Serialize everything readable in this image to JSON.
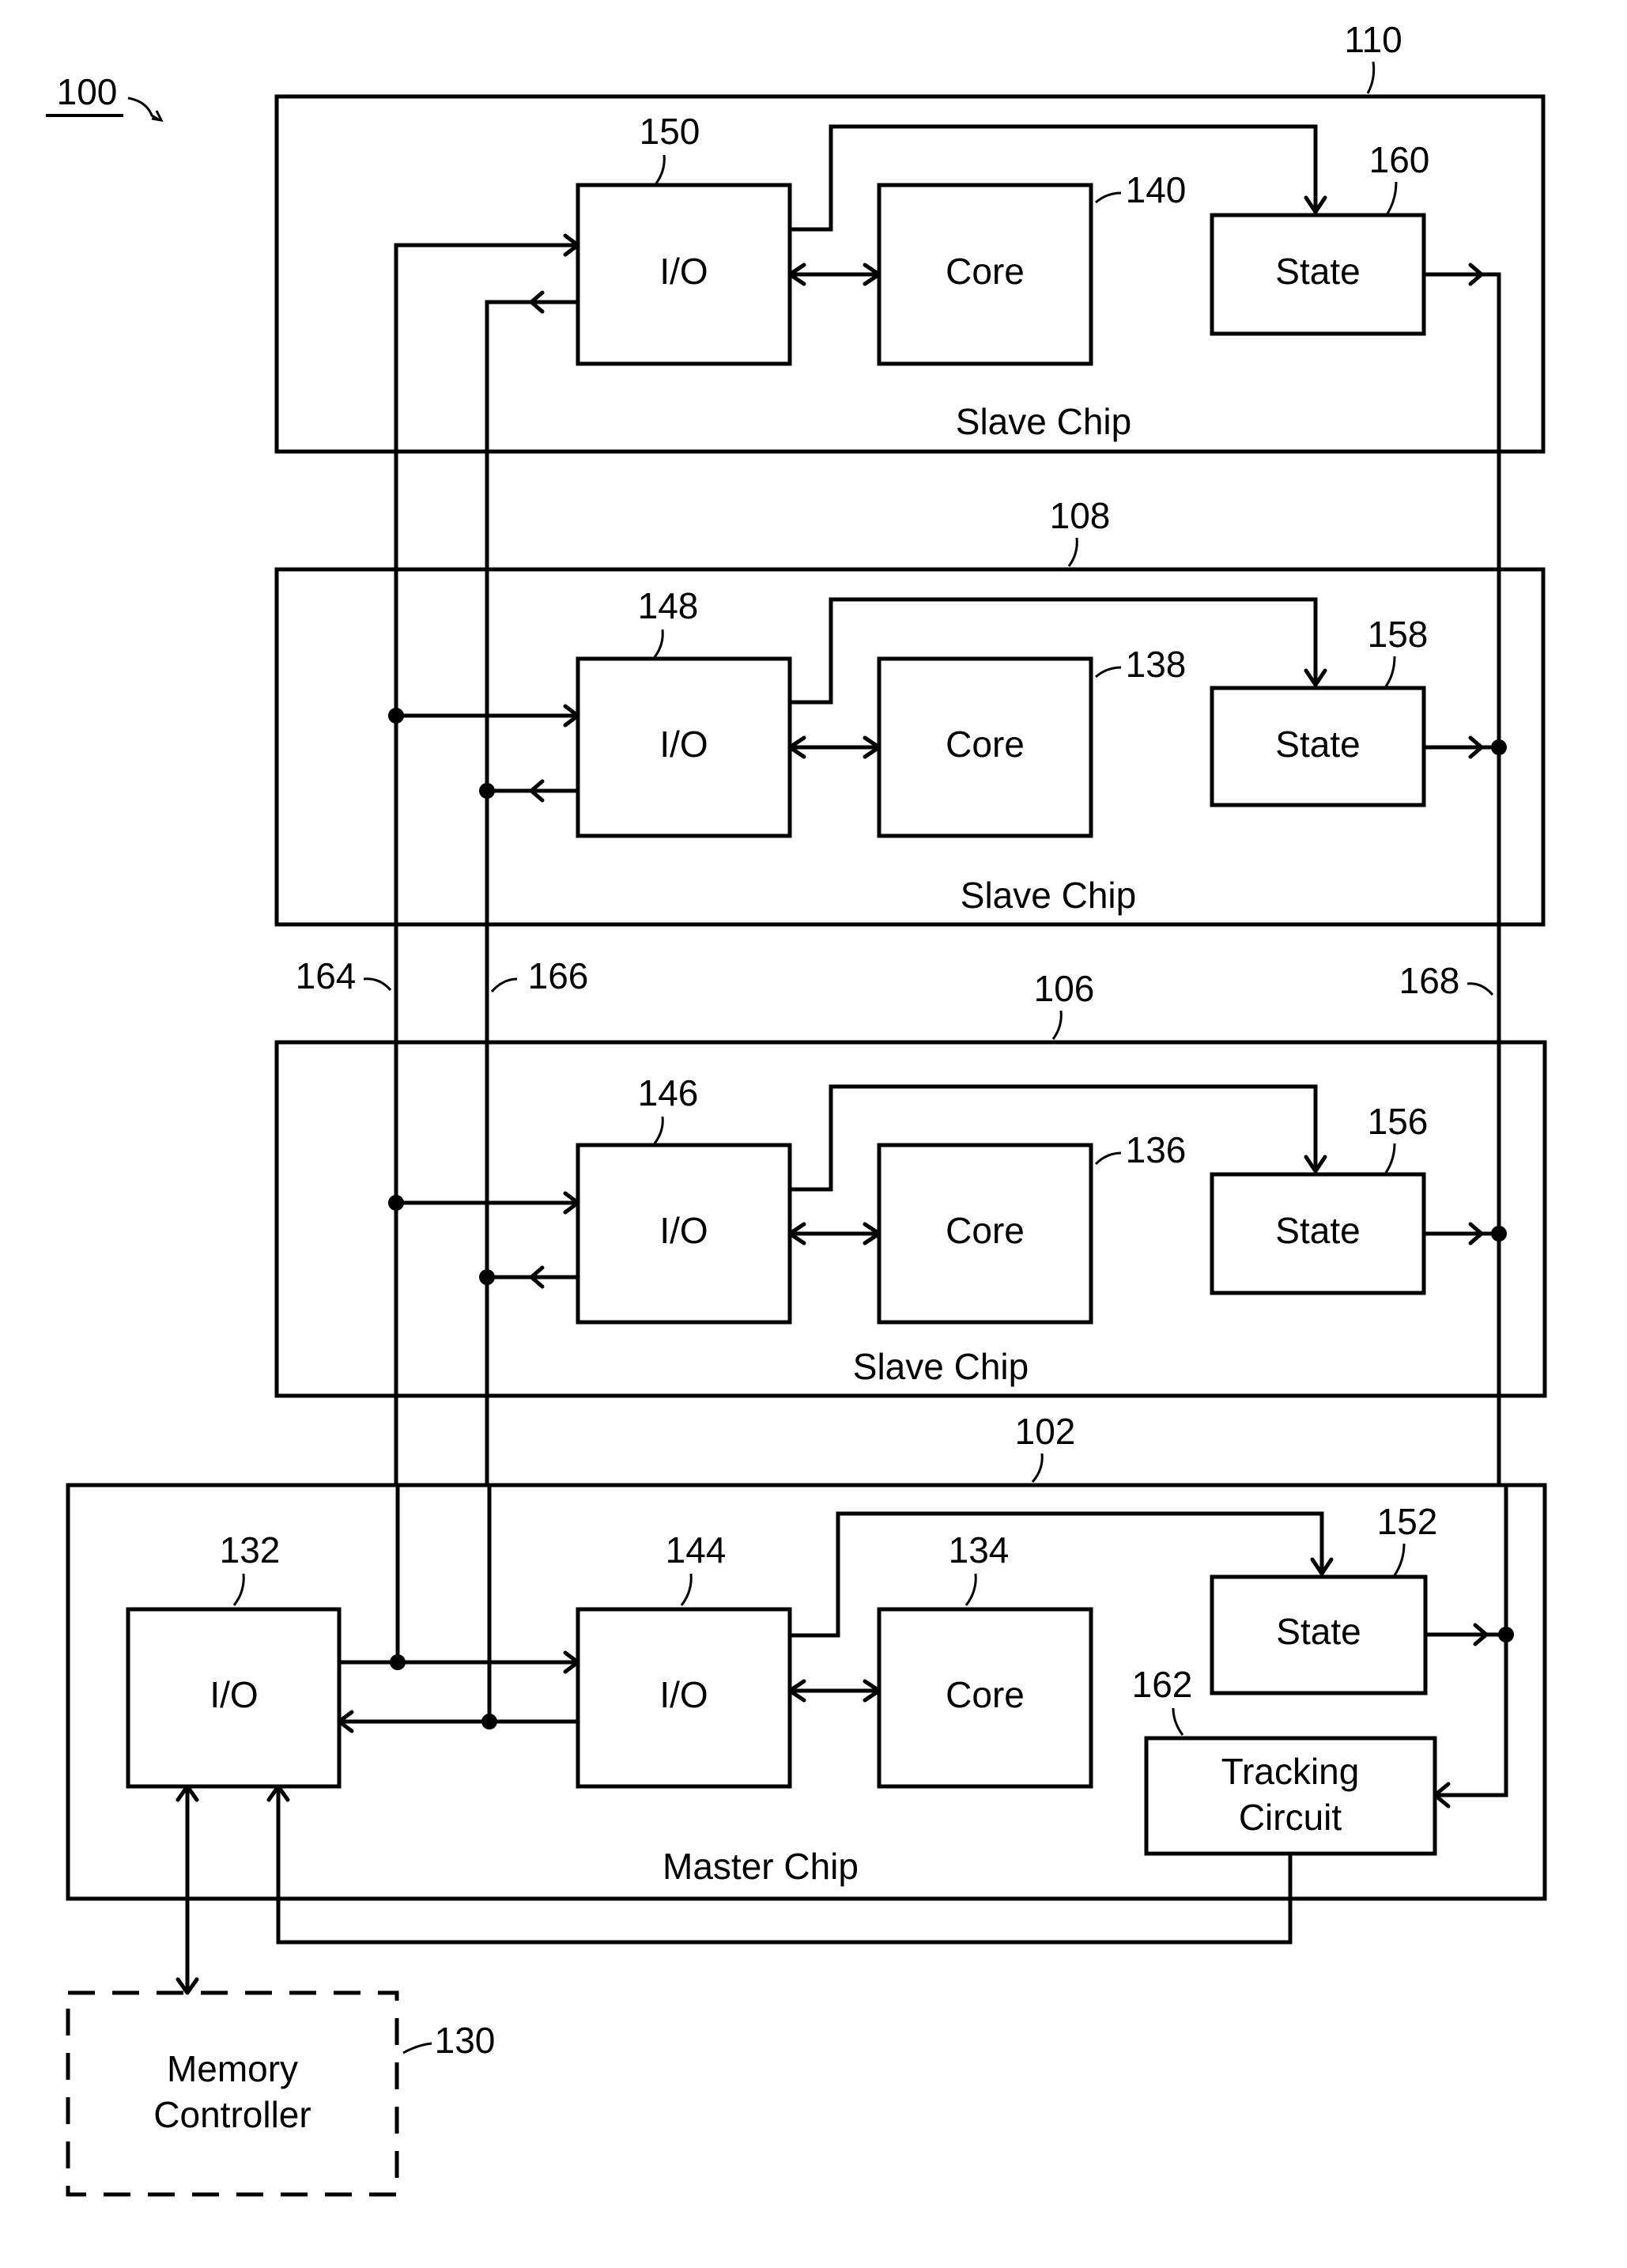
{
  "figure": {
    "ref": "100",
    "colors": {
      "line": "#000000",
      "background": "#ffffff"
    }
  },
  "chips": [
    {
      "ref": "110",
      "label": "Slave Chip",
      "io": {
        "ref": "150",
        "label": "I/O"
      },
      "core": {
        "ref": "140",
        "label": "Core"
      },
      "state": {
        "ref": "160",
        "label": "State"
      }
    },
    {
      "ref": "108",
      "label": "Slave Chip",
      "io": {
        "ref": "148",
        "label": "I/O"
      },
      "core": {
        "ref": "138",
        "label": "Core"
      },
      "state": {
        "ref": "158",
        "label": "State"
      }
    },
    {
      "ref": "106",
      "label": "Slave Chip",
      "io": {
        "ref": "146",
        "label": "I/O"
      },
      "core": {
        "ref": "136",
        "label": "Core"
      },
      "state": {
        "ref": "156",
        "label": "State"
      }
    },
    {
      "ref": "102",
      "label": "Master Chip",
      "io": {
        "ref": "144",
        "label": "I/O"
      },
      "core": {
        "ref": "134",
        "label": "Core"
      },
      "state": {
        "ref": "152",
        "label": "State"
      }
    }
  ],
  "master": {
    "external_io": {
      "ref": "132",
      "label": "I/O"
    },
    "tracking": {
      "ref": "162",
      "line1": "Tracking",
      "line2": "Circuit"
    }
  },
  "memory_controller": {
    "ref": "130",
    "line1": "Memory",
    "line2": "Controller"
  },
  "buses": [
    {
      "ref": "164"
    },
    {
      "ref": "166"
    },
    {
      "ref": "168"
    }
  ]
}
